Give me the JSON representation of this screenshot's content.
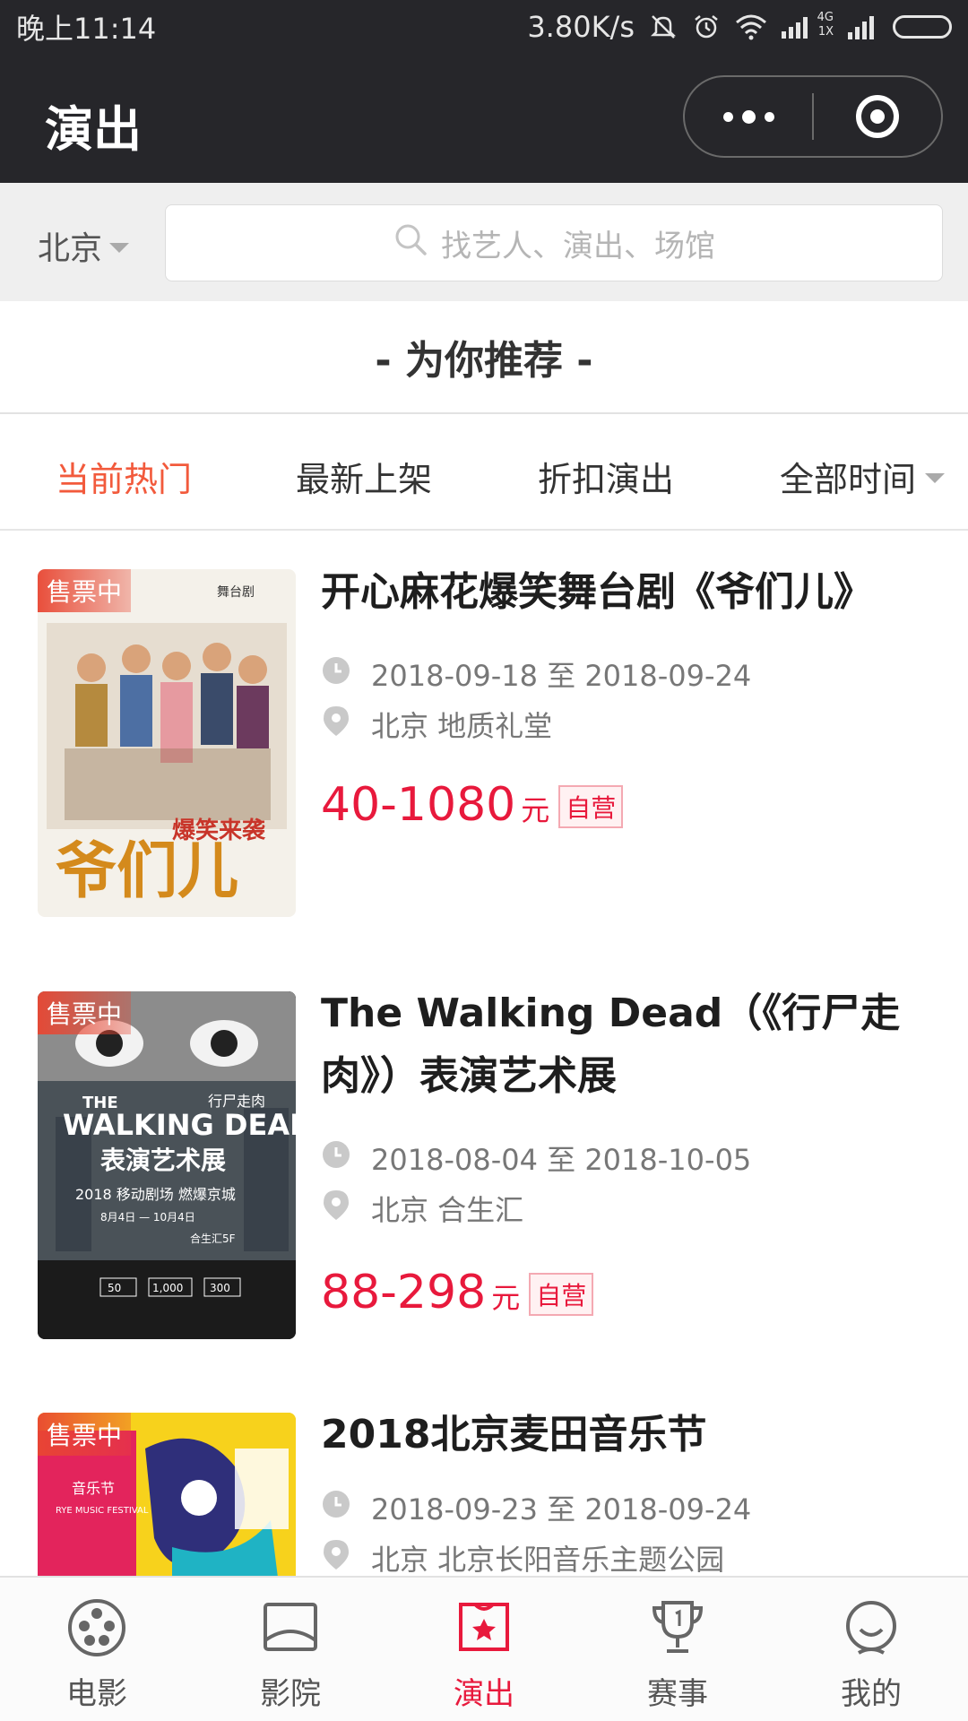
{
  "status_bar": {
    "time": "晚上11:14",
    "net_speed": "3.80K/s",
    "icons": [
      "bell-off-icon",
      "alarm-icon",
      "wifi-icon",
      "signal-4g-icon",
      "signal-icon",
      "battery-icon"
    ],
    "network_label_top": "4G",
    "network_label_bottom": "1X"
  },
  "header": {
    "title": "演出",
    "more_icon": "more-dots-icon",
    "close_icon": "target-icon"
  },
  "search": {
    "city": "北京",
    "placeholder": "找艺人、演出、场馆"
  },
  "recommend_title": "- 为你推荐 -",
  "filters": [
    {
      "label": "当前热门",
      "active": true
    },
    {
      "label": "最新上架",
      "active": false
    },
    {
      "label": "折扣演出",
      "active": false
    },
    {
      "label": "全部时间",
      "active": false
    }
  ],
  "events": [
    {
      "badge": "售票中",
      "title": "开心麻花爆笑舞台剧《爷们儿》",
      "dates": "2018-09-18 至 2018-09-24",
      "venue": "北京 地质礼堂",
      "price": "40-1080",
      "unit": "元",
      "tag": "自营",
      "poster_text": "爷们儿",
      "poster_sub": "爆笑来袭",
      "poster_corner": "舞台剧"
    },
    {
      "badge": "售票中",
      "title_line1": "The Walking Dead（《行尸走",
      "title_line2": "肉》）表演艺术展",
      "dates": "2018-08-04 至 2018-10-05",
      "venue": "北京 合生汇",
      "price": "88-298",
      "unit": "元",
      "tag": "自营",
      "poster_en1": "THE",
      "poster_en2": "WALKING DEAD",
      "poster_cn": "表演艺术展",
      "poster_cn_small": "行尸走肉",
      "poster_line": "2018 移动剧场 燃爆京城",
      "poster_dates": "8月4日 — 10月4日",
      "poster_venue": "合生汇5F",
      "poster_prices": [
        "50",
        "1,000",
        "300"
      ]
    },
    {
      "badge": "售票中",
      "title": "2018北京麦田音乐节",
      "dates": "2018-09-23 至 2018-09-24",
      "venue": "北京 北京长阳音乐主题公园",
      "poster_cn": "音乐节",
      "poster_en": "RYE MUSIC FESTIVAL"
    }
  ],
  "tabbar": [
    {
      "label": "电影",
      "icon": "film-reel-icon",
      "active": false
    },
    {
      "label": "影院",
      "icon": "cinema-screen-icon",
      "active": false
    },
    {
      "label": "演出",
      "icon": "ticket-star-icon",
      "active": true
    },
    {
      "label": "赛事",
      "icon": "trophy-icon",
      "active": false
    },
    {
      "label": "我的",
      "icon": "profile-face-icon",
      "active": false
    }
  ],
  "colors": {
    "accent": "#e8193c",
    "tab_active": "#f25a3c",
    "header_bg": "#26262a"
  }
}
